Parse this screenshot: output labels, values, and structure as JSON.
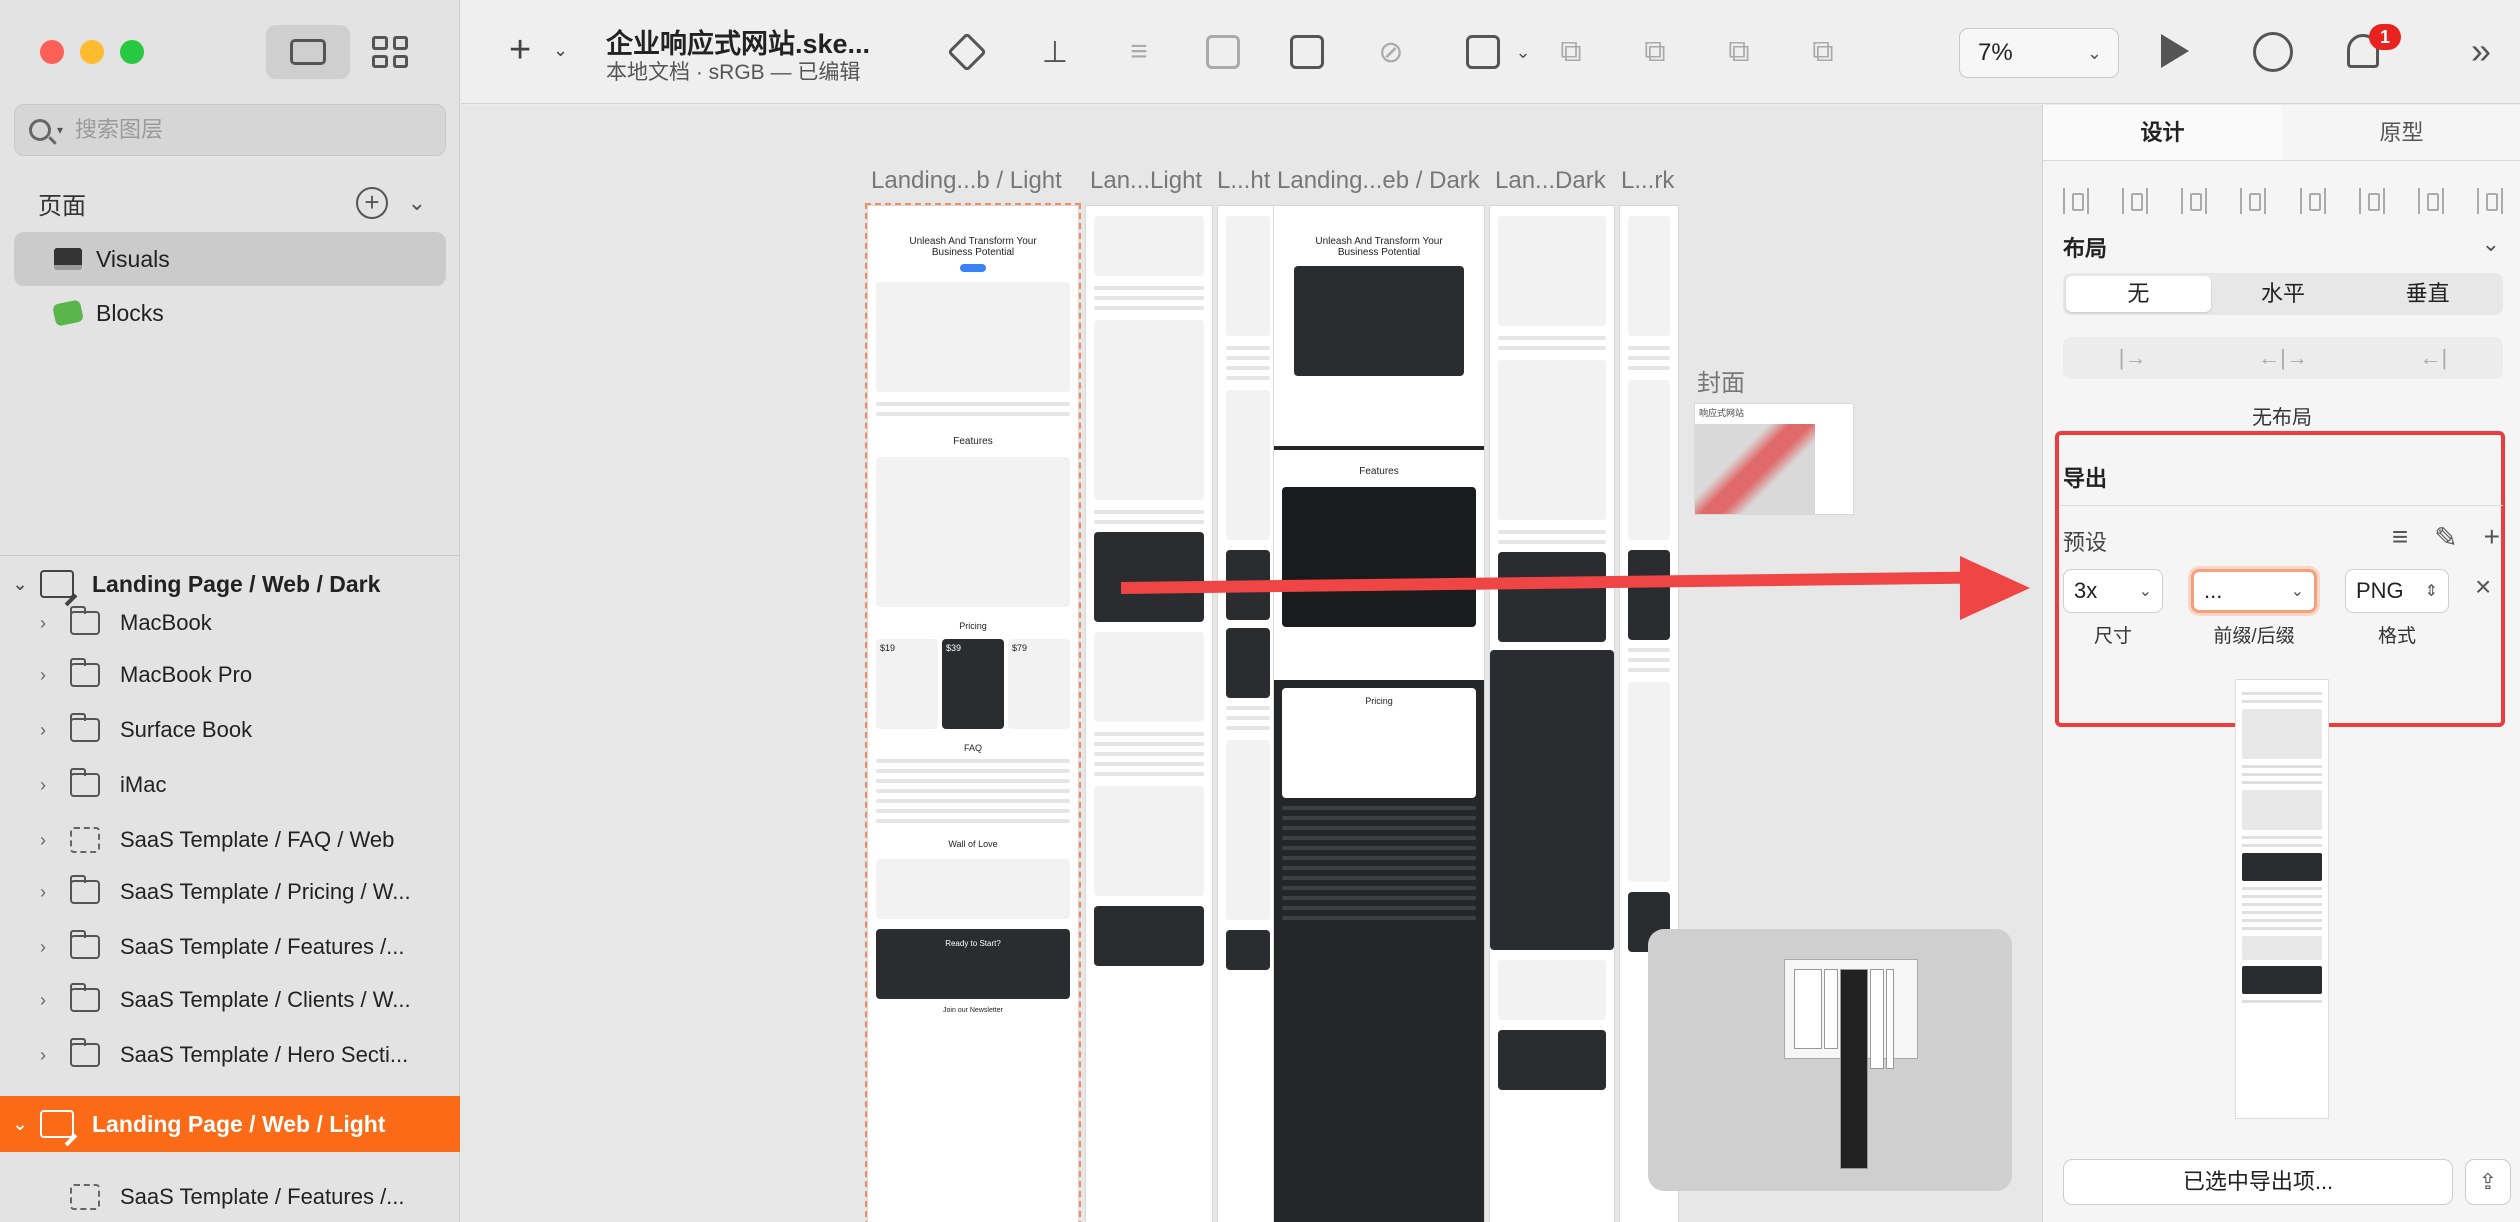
{
  "window": {
    "controls": [
      "close",
      "minimize",
      "zoom"
    ]
  },
  "sidebar": {
    "search_placeholder": "搜索图层",
    "pages_title": "页面",
    "pages": [
      {
        "label": "Visuals",
        "icon": "monitor-icon",
        "selected": true
      },
      {
        "label": "Blocks",
        "icon": "puzzle-icon",
        "selected": false
      }
    ],
    "groups": [
      {
        "label": "Landing Page / Web / Dark",
        "expanded": true,
        "active": false
      },
      {
        "label": "Landing Page / Web / Light",
        "expanded": true,
        "active": true
      }
    ],
    "layers": [
      "MacBook",
      "MacBook Pro",
      "Surface Book",
      "iMac",
      "SaaS Template / FAQ / Web",
      "SaaS Template / Pricing / W...",
      "SaaS Template / Features /...",
      "SaaS Template / Clients / W...",
      "SaaS Template / Hero Secti..."
    ],
    "light_child": "SaaS Template / Features /..."
  },
  "toolbar": {
    "doc_title": "企业响应式网站.ske...",
    "doc_subtitle": "本地文档 · sRGB — 已编辑",
    "zoom": "7%",
    "notification_count": "1"
  },
  "canvas": {
    "artboard_labels": [
      "Landing...b / Light",
      "Lan...Light",
      "L...ht",
      "Landing...eb / Dark",
      "Lan...Dark",
      "L...rk"
    ],
    "hero_heading": "Unleash And Transform Your Business Potential",
    "section_features": "Features",
    "section_pricing": "Pricing",
    "section_faq": "FAQ",
    "section_wall": "Wall of Love",
    "section_cta": "Ready to Start?",
    "section_newsletter": "Join our Newsletter",
    "price_values": [
      "$19",
      "$39",
      "$79"
    ],
    "cover_label": "封面",
    "cover_title": "响应式网站"
  },
  "inspector": {
    "tabs": [
      {
        "label": "设计",
        "active": true
      },
      {
        "label": "原型",
        "active": false
      }
    ],
    "layout_title": "布局",
    "layout_options": [
      {
        "label": "无",
        "active": true
      },
      {
        "label": "水平",
        "active": false
      },
      {
        "label": "垂直",
        "active": false
      }
    ],
    "no_layout": "无布局",
    "export_title": "导出",
    "preset_label": "预设",
    "size_value": "3x",
    "size_label": "尺寸",
    "prefix_value": "...",
    "prefix_label": "前缀/后缀",
    "format_value": "PNG",
    "format_label": "格式",
    "export_button": "已选中导出项..."
  },
  "colors": {
    "accent_orange": "#fb6a17",
    "highlight_red": "#ee3b3b",
    "badge_red": "#e8231f",
    "cta_blue": "#3b82f6"
  }
}
